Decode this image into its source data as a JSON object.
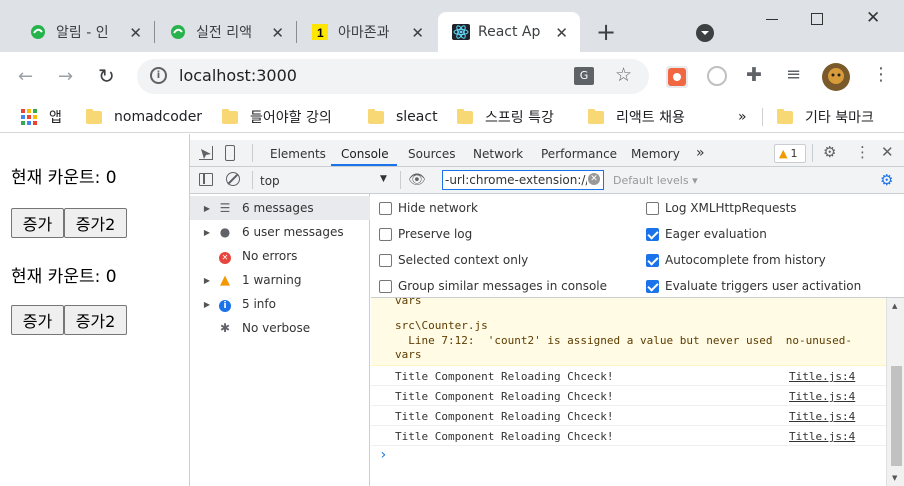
{
  "browser": {
    "tabs": [
      {
        "title": "알림 - 인",
        "icon": "whale-icon"
      },
      {
        "title": "실전 리액",
        "icon": "whale-icon"
      },
      {
        "title": "아마존과",
        "icon": "yellow-one-icon"
      },
      {
        "title": "React Ap",
        "icon": "react-icon"
      }
    ],
    "new_tab": "+",
    "address": "localhost:3000",
    "bookmarks": {
      "apps": "앱",
      "items": [
        "nomadcoder",
        "들어야할 강의",
        "sleact",
        "스프링 특강",
        "리액트 채용"
      ],
      "more": "»",
      "other": "기타 북마크"
    }
  },
  "page": {
    "counters": [
      {
        "label": "현재 카운트: 0",
        "btn1": "증가",
        "btn2": "증가2"
      },
      {
        "label": "현재 카운트: 0",
        "btn1": "증가",
        "btn2": "증가2"
      }
    ]
  },
  "devtools": {
    "tabs": [
      "Elements",
      "Console",
      "Sources",
      "Network",
      "Performance",
      "Memory"
    ],
    "more_tabs": "»",
    "warning_count": "1",
    "context": "top",
    "filter": "-url:chrome-extension://fn",
    "levels": "Default levels ▾",
    "sidebar": [
      {
        "label": "6 messages",
        "icon": "list-icon"
      },
      {
        "label": "6 user messages",
        "icon": "user-icon"
      },
      {
        "label": "No errors",
        "icon": "error-icon"
      },
      {
        "label": "1 warning",
        "icon": "warning-icon"
      },
      {
        "label": "5 info",
        "icon": "info-icon"
      },
      {
        "label": "No verbose",
        "icon": "bug-icon"
      }
    ],
    "settings": {
      "left": [
        {
          "label": "Hide network",
          "checked": false
        },
        {
          "label": "Preserve log",
          "checked": false
        },
        {
          "label": "Selected context only",
          "checked": false
        },
        {
          "label": "Group similar messages in console",
          "checked": false
        }
      ],
      "right": [
        {
          "label": "Log XMLHttpRequests",
          "checked": false
        },
        {
          "label": "Eager evaluation",
          "checked": true
        },
        {
          "label": "Autocomplete from history",
          "checked": true
        },
        {
          "label": "Evaluate triggers user activation",
          "checked": true
        }
      ]
    },
    "warning_lines": [
      "vars",
      "src\\Counter.js",
      "  Line 7:12:  'count2' is assigned a value but never used  no-unused-",
      "vars"
    ],
    "logs": [
      {
        "message": "Title Component Reloading Chceck!",
        "source": "Title.js:4"
      },
      {
        "message": "Title Component Reloading Chceck!",
        "source": "Title.js:4"
      },
      {
        "message": "Title Component Reloading Chceck!",
        "source": "Title.js:4"
      },
      {
        "message": "Title Component Reloading Chceck!",
        "source": "Title.js:4"
      }
    ],
    "prompt": "›"
  }
}
